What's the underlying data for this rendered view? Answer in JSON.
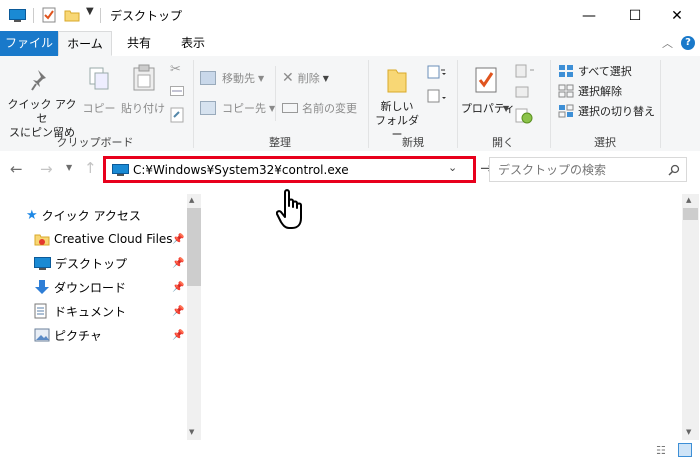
{
  "window": {
    "title": "デスクトップ",
    "minimize": "—",
    "maximize": "☐",
    "close": "✕"
  },
  "tabs": {
    "file": "ファイル",
    "home": "ホーム",
    "share": "共有",
    "view": "表示",
    "help_icon": "?"
  },
  "ribbon": {
    "clipboard": {
      "label": "クリップボード",
      "pin_line1": "クイック アクセ",
      "pin_line2": "スにピン留め",
      "copy": "コピー",
      "paste": "貼り付け"
    },
    "organize": {
      "label": "整理",
      "move_to": "移動先",
      "copy_to": "コピー先",
      "delete": "削除",
      "rename": "名前の変更"
    },
    "new": {
      "label": "新規",
      "new_folder_line1": "新しい",
      "new_folder_line2": "フォルダー"
    },
    "open": {
      "label": "開く",
      "properties": "プロパティ"
    },
    "select": {
      "label": "選択",
      "select_all": "すべて選択",
      "select_none": "選択解除",
      "invert": "選択の切り替え"
    }
  },
  "address": {
    "path": "C:¥Windows¥System32¥control.exe",
    "search_placeholder": "デスクトップの検索"
  },
  "nav": {
    "quick_access": "クイック アクセス",
    "items": [
      {
        "label": "Creative Cloud Files"
      },
      {
        "label": "デスクトップ"
      },
      {
        "label": "ダウンロード"
      },
      {
        "label": "ドキュメント"
      },
      {
        "label": "ピクチャ"
      }
    ]
  },
  "colors": {
    "accent": "#1979ca",
    "highlight_border": "#e8001c"
  }
}
